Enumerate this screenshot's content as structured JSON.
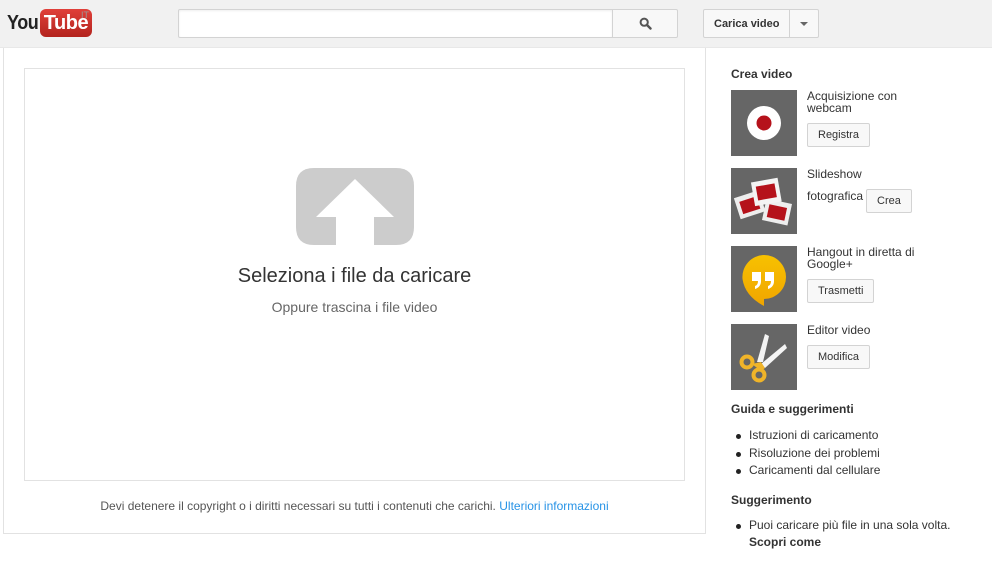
{
  "header": {
    "logo_you": "You",
    "logo_tube": "Tube",
    "country_code": "IT",
    "search_value": "",
    "search_placeholder": "",
    "search_icon": "magnifier-icon",
    "upload_button_label": "Carica video",
    "upload_menu_icon": "caret-down-icon"
  },
  "main": {
    "drop_icon": "upload-arrow-icon",
    "drop_title": "Seleziona i file da caricare",
    "drop_subtitle": "Oppure trascina i file video",
    "copyright_text": "Devi detenere il copyright o i diritti necessari su tutti i contenuti che carichi.",
    "copyright_link": "Ulteriori informazioni",
    "colors": {
      "link": "#2793e6",
      "icon_gray": "#cccccc"
    }
  },
  "sidebar": {
    "create_title": "Crea video",
    "create_items": [
      {
        "label": "Acquisizione con webcam",
        "button": "Registra",
        "icon": "webcam-record-icon"
      },
      {
        "label_line1": "Slideshow",
        "label_line2": "fotografica",
        "button": "Crea",
        "icon": "photo-slideshow-icon"
      },
      {
        "label": "Hangout in diretta di Google+",
        "button": "Trasmetti",
        "icon": "hangouts-icon"
      },
      {
        "label": "Editor video",
        "button": "Modifica",
        "icon": "scissors-icon"
      }
    ],
    "guide_title": "Guida e suggerimenti",
    "guide_links": [
      "Istruzioni di caricamento",
      "Risoluzione dei problemi",
      "Caricamenti dal cellulare"
    ],
    "tip_title": "Suggerimento",
    "tip_text": "Puoi caricare più file in una sola volta.",
    "tip_link": "Scopri come",
    "colors": {
      "thumb_bg": "#666666",
      "record_red": "#b5121b",
      "hangouts_yellow": "#f4b400"
    }
  }
}
